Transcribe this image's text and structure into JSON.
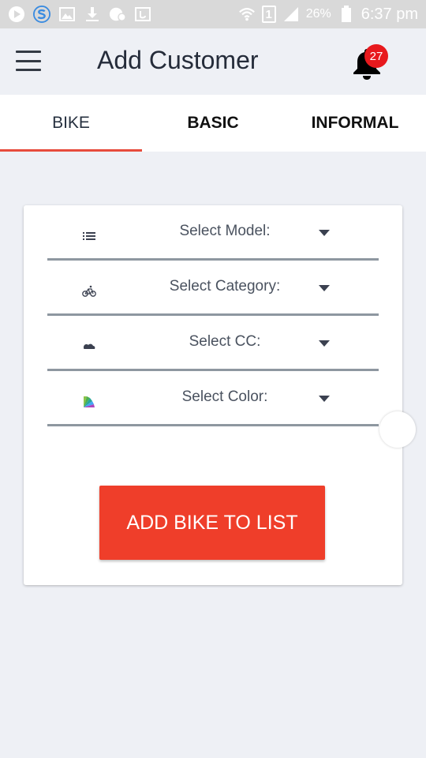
{
  "status_bar": {
    "icons": [
      "play-circle-icon",
      "s-app-icon",
      "image-icon",
      "download-icon",
      "notification-icon",
      "wallet-icon",
      "wifi-icon",
      "sim-1-icon",
      "signal-icon",
      "battery-icon"
    ],
    "sim_label": "1",
    "battery": "26%",
    "time": "6:37 pm"
  },
  "header": {
    "title": "Add Customer",
    "notification_count": "27"
  },
  "tabs": [
    {
      "label": "BIKE",
      "active": true
    },
    {
      "label": "BASIC",
      "active": false
    },
    {
      "label": "INFORMAL",
      "active": false
    }
  ],
  "form": {
    "fields": [
      {
        "icon": "list-icon",
        "label": "Select Model:"
      },
      {
        "icon": "bicycle-icon",
        "label": "Select Category:"
      },
      {
        "icon": "engine-icon",
        "label": "Select CC:"
      },
      {
        "icon": "color-palette-icon",
        "label": "Select Color:"
      }
    ],
    "submit_label": "ADD BIKE TO LIST"
  },
  "colors": {
    "accent": "#ef3e2a",
    "tab_indicator": "#e74c3c",
    "badge": "#e8191d",
    "background": "#eef0f5"
  }
}
